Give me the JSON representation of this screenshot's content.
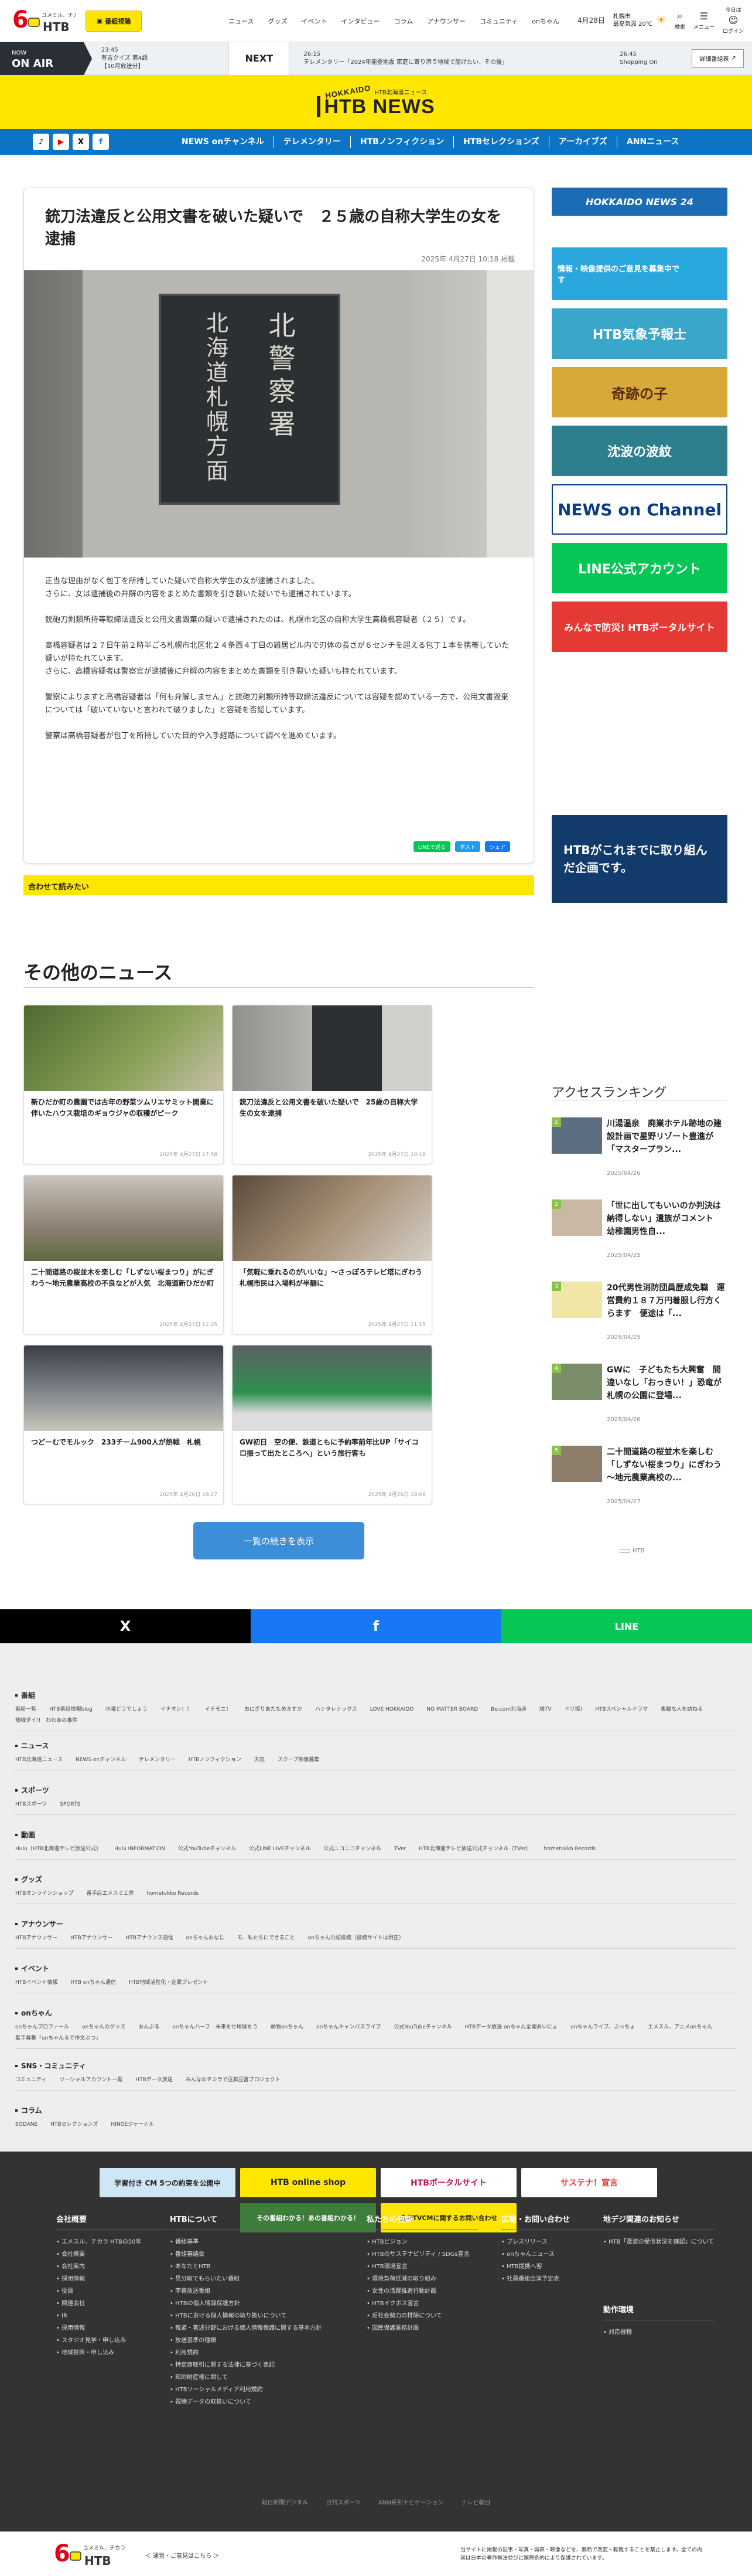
{
  "header": {
    "logo_text_top": "6",
    "logo_text_sub": "ユメミル、チカラ",
    "logo_brand": "HTB",
    "program_btn": "番組視聴",
    "nav": [
      "ニュース",
      "グッズ",
      "イベント",
      "インタビュー",
      "コラム",
      "アナウンサー",
      "コミュニティ",
      "onちゃん"
    ],
    "date": "4月28日",
    "weather_city": "札幌市",
    "weather_text": "最高気温 20℃",
    "icon_search": "検索",
    "icon_menu": "メニュー",
    "icon_tv": "今日は",
    "icon_login": "ログイン"
  },
  "onair": {
    "label": "NOW",
    "label2": "ON AIR",
    "time": "23:45",
    "prog": "有吉クイズ 第4話",
    "prog2": "【10月放送分】",
    "next_label": "NEXT",
    "next_time": "26:15",
    "next_prog": "テレメンタリー「2024年能登地震 家庭に寄り添う地域で届けたい、その後」",
    "later_time": "26:45",
    "later_prog": "Shopping On",
    "btn": "詳細番組表"
  },
  "banner": {
    "top": "HOKKAIDO",
    "sub": "HTB北海道ニュース",
    "brand": "HTB NEWS"
  },
  "bluenav": {
    "sns": [
      "♪",
      "▶",
      "X",
      "f"
    ],
    "items": [
      "NEWS onチャンネル",
      "テレメンタリー",
      "HTBノンフィクション",
      "HTBセレクションズ",
      "アーカイブズ",
      "ANNニュース"
    ]
  },
  "article": {
    "title": "銃刀法違反と公用文書を破いた疑いで　２５歳の自称大学生の女を逮捕",
    "date": "2025年 4月27日 10:18 掲載",
    "sign_line1": "北海道札幌方面",
    "sign_line2": "北警察署",
    "paragraphs": [
      "正当な理由がなく包丁を所持していた疑いで自称大学生の女が逮捕されました。\nさらに、女は逮捕後の弁解の内容をまとめた書類を引き裂いた疑いでも逮捕されています。",
      "銃砲刀剣類所持等取締法違反と公用文書毀棄の疑いで逮捕されたのは、札幌市北区の自称大学生高橋楓容疑者（２５）です。",
      "高橋容疑者は２７日午前２時半ごろ札幌市北区北２４条西４丁目の雑居ビル内で刃体の長さが６センチを超える包丁１本を携帯していた疑いが持たれています。\nさらに、高橋容疑者は警察官が逮捕後に弁解の内容をまとめた書類を引き裂いた疑いも持たれています。",
      "警察によりますと高橋容疑者は「何も弁解しません」と銃砲刀剣類所持等取締法違反については容疑を認めている一方で、公用文書毀棄については「破いていないと言われて破りました」と容疑を否認しています。",
      "警察は高橋容疑者が包丁を所持していた目的や入手経路について調べを進めています。"
    ],
    "share": [
      "LINEで送る",
      "ポスト",
      "シェア"
    ]
  },
  "also_read": "合わせて読みたい",
  "side_banners": [
    "HOKKAIDO NEWS 24",
    "情報・映像提供のご意見を募集中です",
    "HTB気象予報士",
    "奇跡の子",
    "沈波の波紋",
    "NEWS on Channel",
    "LINE公式アカウント",
    "みんなで防災! HTBポータルサイト"
  ],
  "side_promo": "HTBがこれまでに取り組んだ企画です。",
  "other_news": {
    "heading": "その他のニュース",
    "cards": [
      {
        "title": "新ひだか町の農園では古年の野菜ツムリエサミット開業に伴いたハウス栽培のギョウジャの収穫がピーク",
        "date": "2025年 4月27日 17:58"
      },
      {
        "title": "銃刀法違反と公用文書を破いた疑いで　25歳の自称大学生の女を逮捕",
        "date": "2025年 4月27日 10:18"
      },
      {
        "title": "二十間道路の桜並木を楽しむ「しずない桜まつり」がにぎわう～地元農業高校の不良などが人気　北海道新ひだか町",
        "date": "2025年 4月27日 11:25"
      },
      {
        "title": "「気軽に乗れるのがいいな」～さっぽろテレビ塔にぎわう　札幌市民は入場料が半額に",
        "date": "2025年 4月27日 11:15"
      },
      {
        "title": "つどーむでモルック　233チーム900人が熱戦　札幌",
        "date": "2025年 4月26日 18:27"
      },
      {
        "title": "GW初日　空の便、鉄道ともに予約率前年比UP「サイコロ振って出たところへ」という旅行客も",
        "date": "2025年 4月26日 18:06"
      }
    ],
    "more": "一覧の続きを表示"
  },
  "ranking": {
    "heading": "アクセスランキング",
    "items": [
      {
        "rank": "1",
        "title": "川湯温泉　廃業ホテル跡地の建設計画で星野リゾート豊進が「マスタープラン...",
        "date": "2025/04/26"
      },
      {
        "rank": "2",
        "title": "「世に出してもいいのか判決は納得しない」遺族がコメント　幼稚園男性自...",
        "date": "2025/04/25"
      },
      {
        "rank": "3",
        "title": "20代男性消防団員歴成免職　運営費約１８７万円着服し行方くらます　便途は「...",
        "date": "2025/04/25"
      },
      {
        "rank": "4",
        "title": "GWに　子どもたち大興奮　間違いなし「おっきい！」恐竜が札幌の公園に登場...",
        "date": "2025/04/26"
      },
      {
        "rank": "5",
        "title": "二十間道路の桜並木を楽しむ「しずない桜まつり」にぎわう～地元農業高校の...",
        "date": "2025/04/27"
      }
    ]
  },
  "pager": "HTB",
  "sharebar": [
    "X",
    "f",
    "LINE"
  ],
  "sitemap": [
    {
      "h": "番組",
      "links": [
        "番組一覧",
        "HTB番組情報blog",
        "水曜どうでしょう",
        "イチオシ！！",
        "イチモニ！",
        "おにぎりあたためますか",
        "ハナタレナックス",
        "LOVE HOKKAIDO",
        "NO MATTER BOARD",
        "Be.com北海道",
        "鳩TV",
        "ドリ探!",
        "HTBスペシャルドラマ",
        "素敵な人を訪ねる",
        "熱戦ダイ!!　わわあの事件"
      ]
    },
    {
      "h": "ニュース",
      "links": [
        "HTB北海道ニュース",
        "NEWS onチャンネル",
        "テレメンタリー",
        "HTBノンフィクション",
        "天気",
        "スクープ映像募集"
      ]
    },
    {
      "h": "スポーツ",
      "links": [
        "HTBスポーツ",
        "SPORTS"
      ]
    },
    {
      "h": "動画",
      "links": [
        "Hulu（HTB北海道テレビ放送公式）",
        "Hulu INFORMATION",
        "公式YouTubeチャンネル",
        "公式LINE LIVEチャンネル",
        "公式ニコニコチャンネル",
        "TVer",
        "HTB北海道テレビ放送公式チャンネル（TVer）",
        "hometvkko Records"
      ]
    },
    {
      "h": "グッズ",
      "links": [
        "HTBオンラインショップ",
        "番手店エメスミ工房",
        "hometvkko Records"
      ]
    },
    {
      "h": "アナウンサー",
      "links": [
        "HTBアナウンサー",
        "HTBアナウンサー",
        "HTBアナウンス通信",
        "onちゃんおなじ",
        "モ、私たちにできること",
        "onちゃん公認投稿（投稿サイトは現在）"
      ]
    },
    {
      "h": "イベント",
      "links": [
        "HTBイベント情報",
        "HTB onちゃん通信",
        "HTB地域活性化・企業プレゼント"
      ]
    },
    {
      "h": "onちゃん",
      "links": [
        "onちゃんプロフィール",
        "onちゃんのグッズ",
        "おんぷる",
        "onちゃんハーフ　未来をせ地球をう",
        "動物onちゃん",
        "onちゃんキャンパスライブ",
        "公式YouTubeチャンネル",
        "HTBデータ放送 onちゃん全開あいにょ",
        "onちゃんライブ、ぶっちょ",
        "エメスル、アニメonちゃん",
        "着手募集「onちゃんるで作文ぶつ」"
      ]
    },
    {
      "h": "SNS・コミュニティ",
      "links": [
        "コミュニティ",
        "ソーシャルアカウント一覧",
        "HTBデータ放送",
        "みんなのチカラで豆腐豆富プロジェクト"
      ]
    },
    {
      "h": "コラム",
      "links": [
        "SODANE",
        "HTBセレクションズ",
        "HINGEジャーナル"
      ]
    }
  ],
  "footer_banners": [
    "学習付き CM 5つの約束を公開中",
    "HTB online shop",
    "HTBポータルサイト",
    "サステナ！宣言",
    "その番組わかる！あの番組わかる！",
    "広告TVCMに関するお問い合わせ"
  ],
  "footer_cols": [
    {
      "h": "会社概要",
      "links": [
        "エメスル、チカラ HTBの50年",
        "会社概要",
        "会社案内",
        "採用情報",
        "役員",
        "関連会社",
        "IR",
        "採用情報",
        "スタジオ見学・申し込み",
        "地域振興・申し込み"
      ]
    },
    {
      "h": "HTBについて",
      "links": [
        "番組基準",
        "番組審議会",
        "あなたとHTB",
        "見分取でもらいたい番組",
        "字幕放送番組",
        "HTBの個人情報保護方針",
        "HTBにおける個人情報の取り扱いについて",
        "報道・著述分野における個人情報保護に関する基本方針",
        "放送基準の種類",
        "利用規約",
        "特定商取引に関する法律に基づく表記",
        "知的財産権に関して",
        "HTBソーシャルメディア利用規約",
        "視聴データの取扱いについて"
      ]
    },
    {
      "h": "私たちの姿勢",
      "links": [
        "HTBビジョン",
        "HTBのサステナビリティ / SDGs宣言",
        "HTB環境宣言",
        "環境負荷低減の取り組み",
        "女性の活躍推進行動計画",
        "HTBイクボス宣言",
        "反社会勢力の排除について",
        "国民保護業務計画"
      ]
    },
    {
      "h": "広報・お問い合わせ",
      "links": [
        "プレスリリース",
        "onちゃんニュース",
        "HTB提携へ客",
        "社員番組出演予定表"
      ]
    },
    {
      "h": "地デジ関連のお知らせ",
      "links": [
        "HTB「電波の受信状況を確認」について"
      ]
    },
    {
      "h": "動作環境",
      "links": [
        "対応機種"
      ]
    }
  ],
  "footer_bottom": [
    "朝日新聞デジタル",
    "日刊スポーツ",
    "ANN系列ナビゲーション",
    "テレビ朝日"
  ],
  "copyright_text": "＜ 運営・ご意見はこちら ＞",
  "copyright_note": "当サイトに掲載の記事・写真・図表・映像などを、無断で改変・転載することを禁止します。全ての内容は日本の著作権法並びに国際条約により保護されています。"
}
